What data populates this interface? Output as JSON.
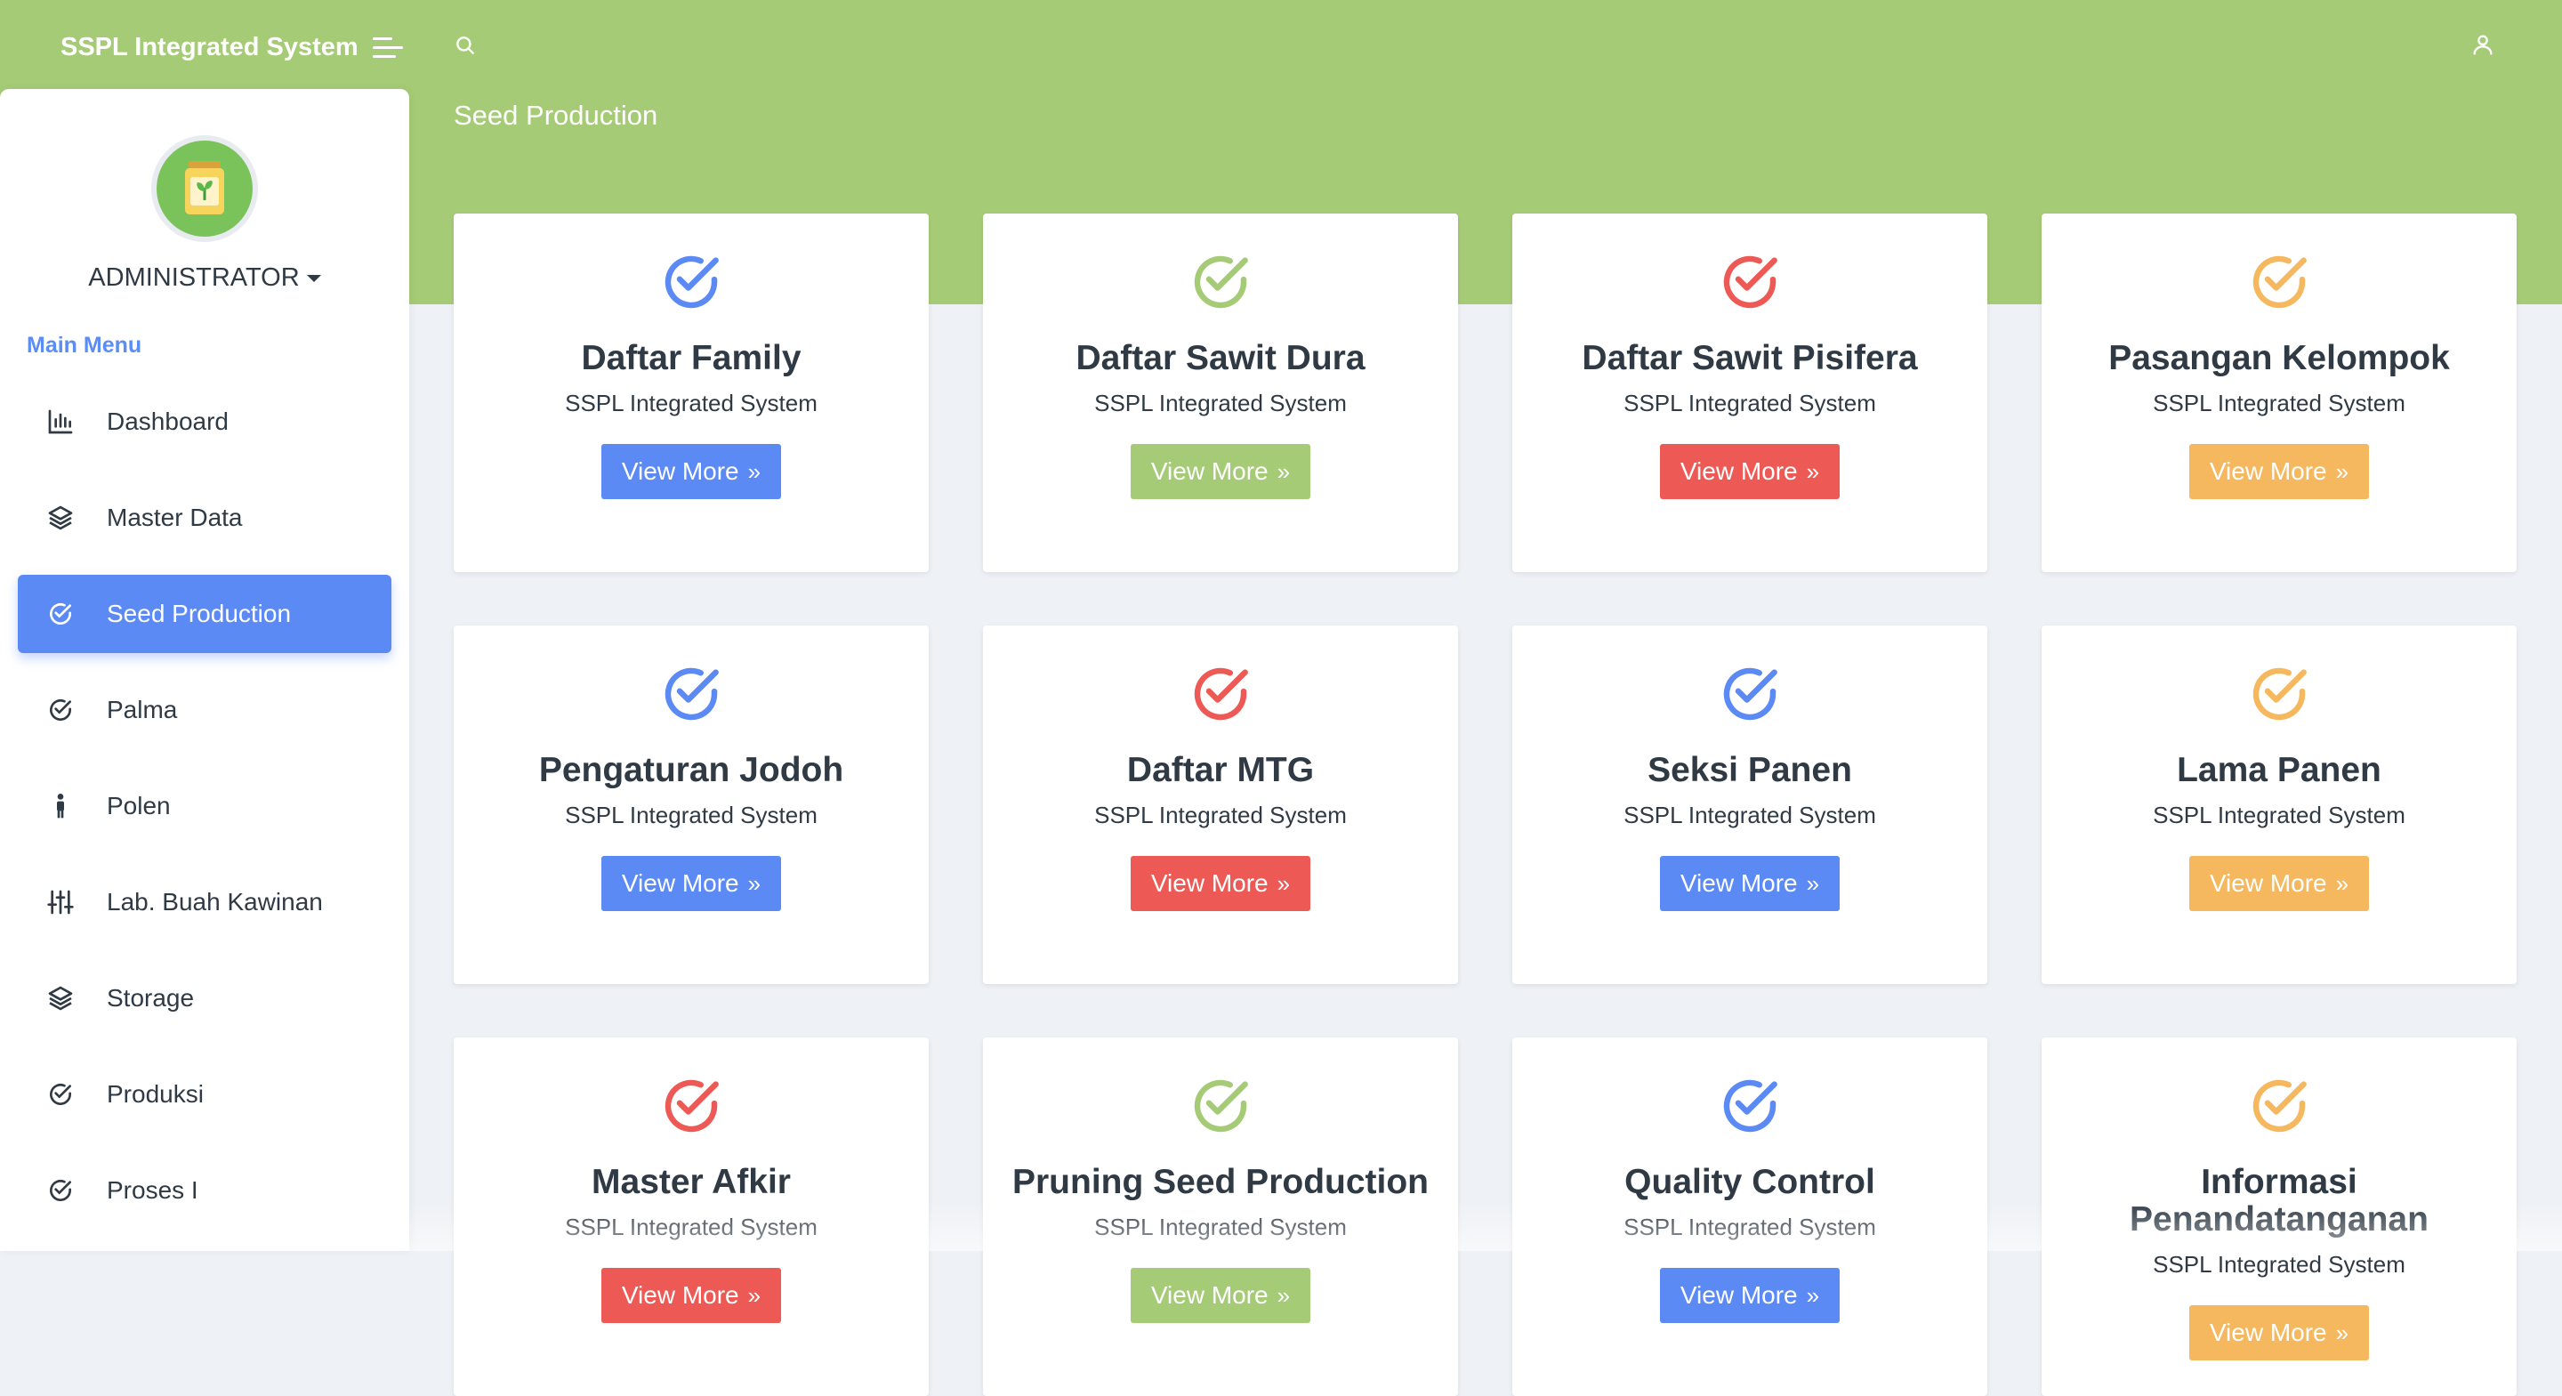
{
  "header": {
    "brand": "SSPL Integrated System",
    "page_title": "Seed Production"
  },
  "user": {
    "name": "ADMINISTRATOR"
  },
  "sidebar": {
    "heading": "Main Menu",
    "items": [
      {
        "label": "Dashboard",
        "icon": "chart-icon"
      },
      {
        "label": "Master Data",
        "icon": "layers-icon"
      },
      {
        "label": "Seed Production",
        "icon": "check-circle-icon",
        "active": true
      },
      {
        "label": "Palma",
        "icon": "check-circle-icon"
      },
      {
        "label": "Polen",
        "icon": "person-icon"
      },
      {
        "label": "Lab. Buah Kawinan",
        "icon": "sliders-icon"
      },
      {
        "label": "Storage",
        "icon": "layers-icon"
      },
      {
        "label": "Produksi",
        "icon": "check-circle-icon"
      },
      {
        "label": "Proses I",
        "icon": "check-circle-icon"
      }
    ]
  },
  "colors": {
    "header_green": "#a6cb76",
    "blue": "#5b8af5",
    "green": "#a6cb76",
    "red": "#ed5a55",
    "orange": "#f5b85e"
  },
  "cards": [
    {
      "title": "Daftar Family",
      "subtitle": "SSPL Integrated System",
      "button": "View More",
      "color": "#5b8af5"
    },
    {
      "title": "Daftar Sawit Dura",
      "subtitle": "SSPL Integrated System",
      "button": "View More",
      "color": "#a6cb76"
    },
    {
      "title": "Daftar Sawit Pisifera",
      "subtitle": "SSPL Integrated System",
      "button": "View More",
      "color": "#ed5a55"
    },
    {
      "title": "Pasangan Kelompok",
      "subtitle": "SSPL Integrated System",
      "button": "View More",
      "color": "#f5b85e"
    },
    {
      "title": "Pengaturan Jodoh",
      "subtitle": "SSPL Integrated System",
      "button": "View More",
      "color": "#5b8af5"
    },
    {
      "title": "Daftar MTG",
      "subtitle": "SSPL Integrated System",
      "button": "View More",
      "color": "#ed5a55"
    },
    {
      "title": "Seksi Panen",
      "subtitle": "SSPL Integrated System",
      "button": "View More",
      "color": "#5b8af5"
    },
    {
      "title": "Lama Panen",
      "subtitle": "SSPL Integrated System",
      "button": "View More",
      "color": "#f5b85e"
    },
    {
      "title": "Master Afkir",
      "subtitle": "SSPL Integrated System",
      "button": "View More",
      "color": "#ed5a55"
    },
    {
      "title": "Pruning Seed Production",
      "subtitle": "SSPL Integrated System",
      "button": "View More",
      "color": "#a6cb76"
    },
    {
      "title": "Quality Control",
      "subtitle": "SSPL Integrated System",
      "button": "View More",
      "color": "#5b8af5"
    },
    {
      "title": "Informasi Penandatanganan",
      "subtitle": "SSPL Integrated System",
      "button": "View More",
      "color": "#f5b85e"
    }
  ]
}
